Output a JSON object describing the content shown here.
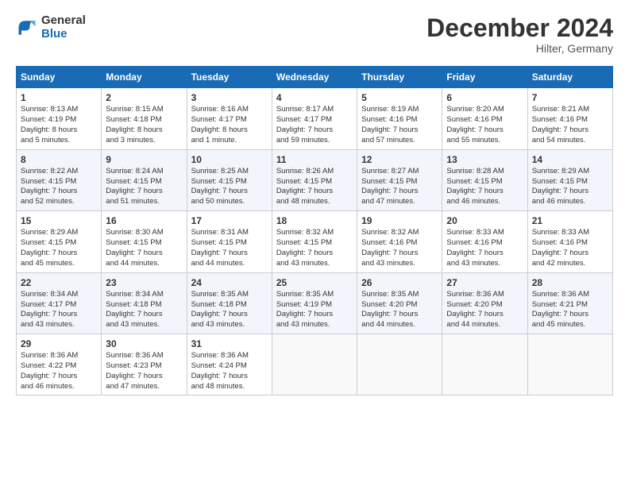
{
  "header": {
    "logo_line1": "General",
    "logo_line2": "Blue",
    "month": "December 2024",
    "location": "Hilter, Germany"
  },
  "days_of_week": [
    "Sunday",
    "Monday",
    "Tuesday",
    "Wednesday",
    "Thursday",
    "Friday",
    "Saturday"
  ],
  "weeks": [
    [
      {
        "day": 1,
        "lines": [
          "Sunrise: 8:13 AM",
          "Sunset: 4:19 PM",
          "Daylight: 8 hours",
          "and 5 minutes."
        ]
      },
      {
        "day": 2,
        "lines": [
          "Sunrise: 8:15 AM",
          "Sunset: 4:18 PM",
          "Daylight: 8 hours",
          "and 3 minutes."
        ]
      },
      {
        "day": 3,
        "lines": [
          "Sunrise: 8:16 AM",
          "Sunset: 4:17 PM",
          "Daylight: 8 hours",
          "and 1 minute."
        ]
      },
      {
        "day": 4,
        "lines": [
          "Sunrise: 8:17 AM",
          "Sunset: 4:17 PM",
          "Daylight: 7 hours",
          "and 59 minutes."
        ]
      },
      {
        "day": 5,
        "lines": [
          "Sunrise: 8:19 AM",
          "Sunset: 4:16 PM",
          "Daylight: 7 hours",
          "and 57 minutes."
        ]
      },
      {
        "day": 6,
        "lines": [
          "Sunrise: 8:20 AM",
          "Sunset: 4:16 PM",
          "Daylight: 7 hours",
          "and 55 minutes."
        ]
      },
      {
        "day": 7,
        "lines": [
          "Sunrise: 8:21 AM",
          "Sunset: 4:16 PM",
          "Daylight: 7 hours",
          "and 54 minutes."
        ]
      }
    ],
    [
      {
        "day": 8,
        "lines": [
          "Sunrise: 8:22 AM",
          "Sunset: 4:15 PM",
          "Daylight: 7 hours",
          "and 52 minutes."
        ]
      },
      {
        "day": 9,
        "lines": [
          "Sunrise: 8:24 AM",
          "Sunset: 4:15 PM",
          "Daylight: 7 hours",
          "and 51 minutes."
        ]
      },
      {
        "day": 10,
        "lines": [
          "Sunrise: 8:25 AM",
          "Sunset: 4:15 PM",
          "Daylight: 7 hours",
          "and 50 minutes."
        ]
      },
      {
        "day": 11,
        "lines": [
          "Sunrise: 8:26 AM",
          "Sunset: 4:15 PM",
          "Daylight: 7 hours",
          "and 48 minutes."
        ]
      },
      {
        "day": 12,
        "lines": [
          "Sunrise: 8:27 AM",
          "Sunset: 4:15 PM",
          "Daylight: 7 hours",
          "and 47 minutes."
        ]
      },
      {
        "day": 13,
        "lines": [
          "Sunrise: 8:28 AM",
          "Sunset: 4:15 PM",
          "Daylight: 7 hours",
          "and 46 minutes."
        ]
      },
      {
        "day": 14,
        "lines": [
          "Sunrise: 8:29 AM",
          "Sunset: 4:15 PM",
          "Daylight: 7 hours",
          "and 46 minutes."
        ]
      }
    ],
    [
      {
        "day": 15,
        "lines": [
          "Sunrise: 8:29 AM",
          "Sunset: 4:15 PM",
          "Daylight: 7 hours",
          "and 45 minutes."
        ]
      },
      {
        "day": 16,
        "lines": [
          "Sunrise: 8:30 AM",
          "Sunset: 4:15 PM",
          "Daylight: 7 hours",
          "and 44 minutes."
        ]
      },
      {
        "day": 17,
        "lines": [
          "Sunrise: 8:31 AM",
          "Sunset: 4:15 PM",
          "Daylight: 7 hours",
          "and 44 minutes."
        ]
      },
      {
        "day": 18,
        "lines": [
          "Sunrise: 8:32 AM",
          "Sunset: 4:15 PM",
          "Daylight: 7 hours",
          "and 43 minutes."
        ]
      },
      {
        "day": 19,
        "lines": [
          "Sunrise: 8:32 AM",
          "Sunset: 4:16 PM",
          "Daylight: 7 hours",
          "and 43 minutes."
        ]
      },
      {
        "day": 20,
        "lines": [
          "Sunrise: 8:33 AM",
          "Sunset: 4:16 PM",
          "Daylight: 7 hours",
          "and 43 minutes."
        ]
      },
      {
        "day": 21,
        "lines": [
          "Sunrise: 8:33 AM",
          "Sunset: 4:16 PM",
          "Daylight: 7 hours",
          "and 42 minutes."
        ]
      }
    ],
    [
      {
        "day": 22,
        "lines": [
          "Sunrise: 8:34 AM",
          "Sunset: 4:17 PM",
          "Daylight: 7 hours",
          "and 43 minutes."
        ]
      },
      {
        "day": 23,
        "lines": [
          "Sunrise: 8:34 AM",
          "Sunset: 4:18 PM",
          "Daylight: 7 hours",
          "and 43 minutes."
        ]
      },
      {
        "day": 24,
        "lines": [
          "Sunrise: 8:35 AM",
          "Sunset: 4:18 PM",
          "Daylight: 7 hours",
          "and 43 minutes."
        ]
      },
      {
        "day": 25,
        "lines": [
          "Sunrise: 8:35 AM",
          "Sunset: 4:19 PM",
          "Daylight: 7 hours",
          "and 43 minutes."
        ]
      },
      {
        "day": 26,
        "lines": [
          "Sunrise: 8:35 AM",
          "Sunset: 4:20 PM",
          "Daylight: 7 hours",
          "and 44 minutes."
        ]
      },
      {
        "day": 27,
        "lines": [
          "Sunrise: 8:36 AM",
          "Sunset: 4:20 PM",
          "Daylight: 7 hours",
          "and 44 minutes."
        ]
      },
      {
        "day": 28,
        "lines": [
          "Sunrise: 8:36 AM",
          "Sunset: 4:21 PM",
          "Daylight: 7 hours",
          "and 45 minutes."
        ]
      }
    ],
    [
      {
        "day": 29,
        "lines": [
          "Sunrise: 8:36 AM",
          "Sunset: 4:22 PM",
          "Daylight: 7 hours",
          "and 46 minutes."
        ]
      },
      {
        "day": 30,
        "lines": [
          "Sunrise: 8:36 AM",
          "Sunset: 4:23 PM",
          "Daylight: 7 hours",
          "and 47 minutes."
        ]
      },
      {
        "day": 31,
        "lines": [
          "Sunrise: 8:36 AM",
          "Sunset: 4:24 PM",
          "Daylight: 7 hours",
          "and 48 minutes."
        ]
      },
      null,
      null,
      null,
      null
    ]
  ]
}
